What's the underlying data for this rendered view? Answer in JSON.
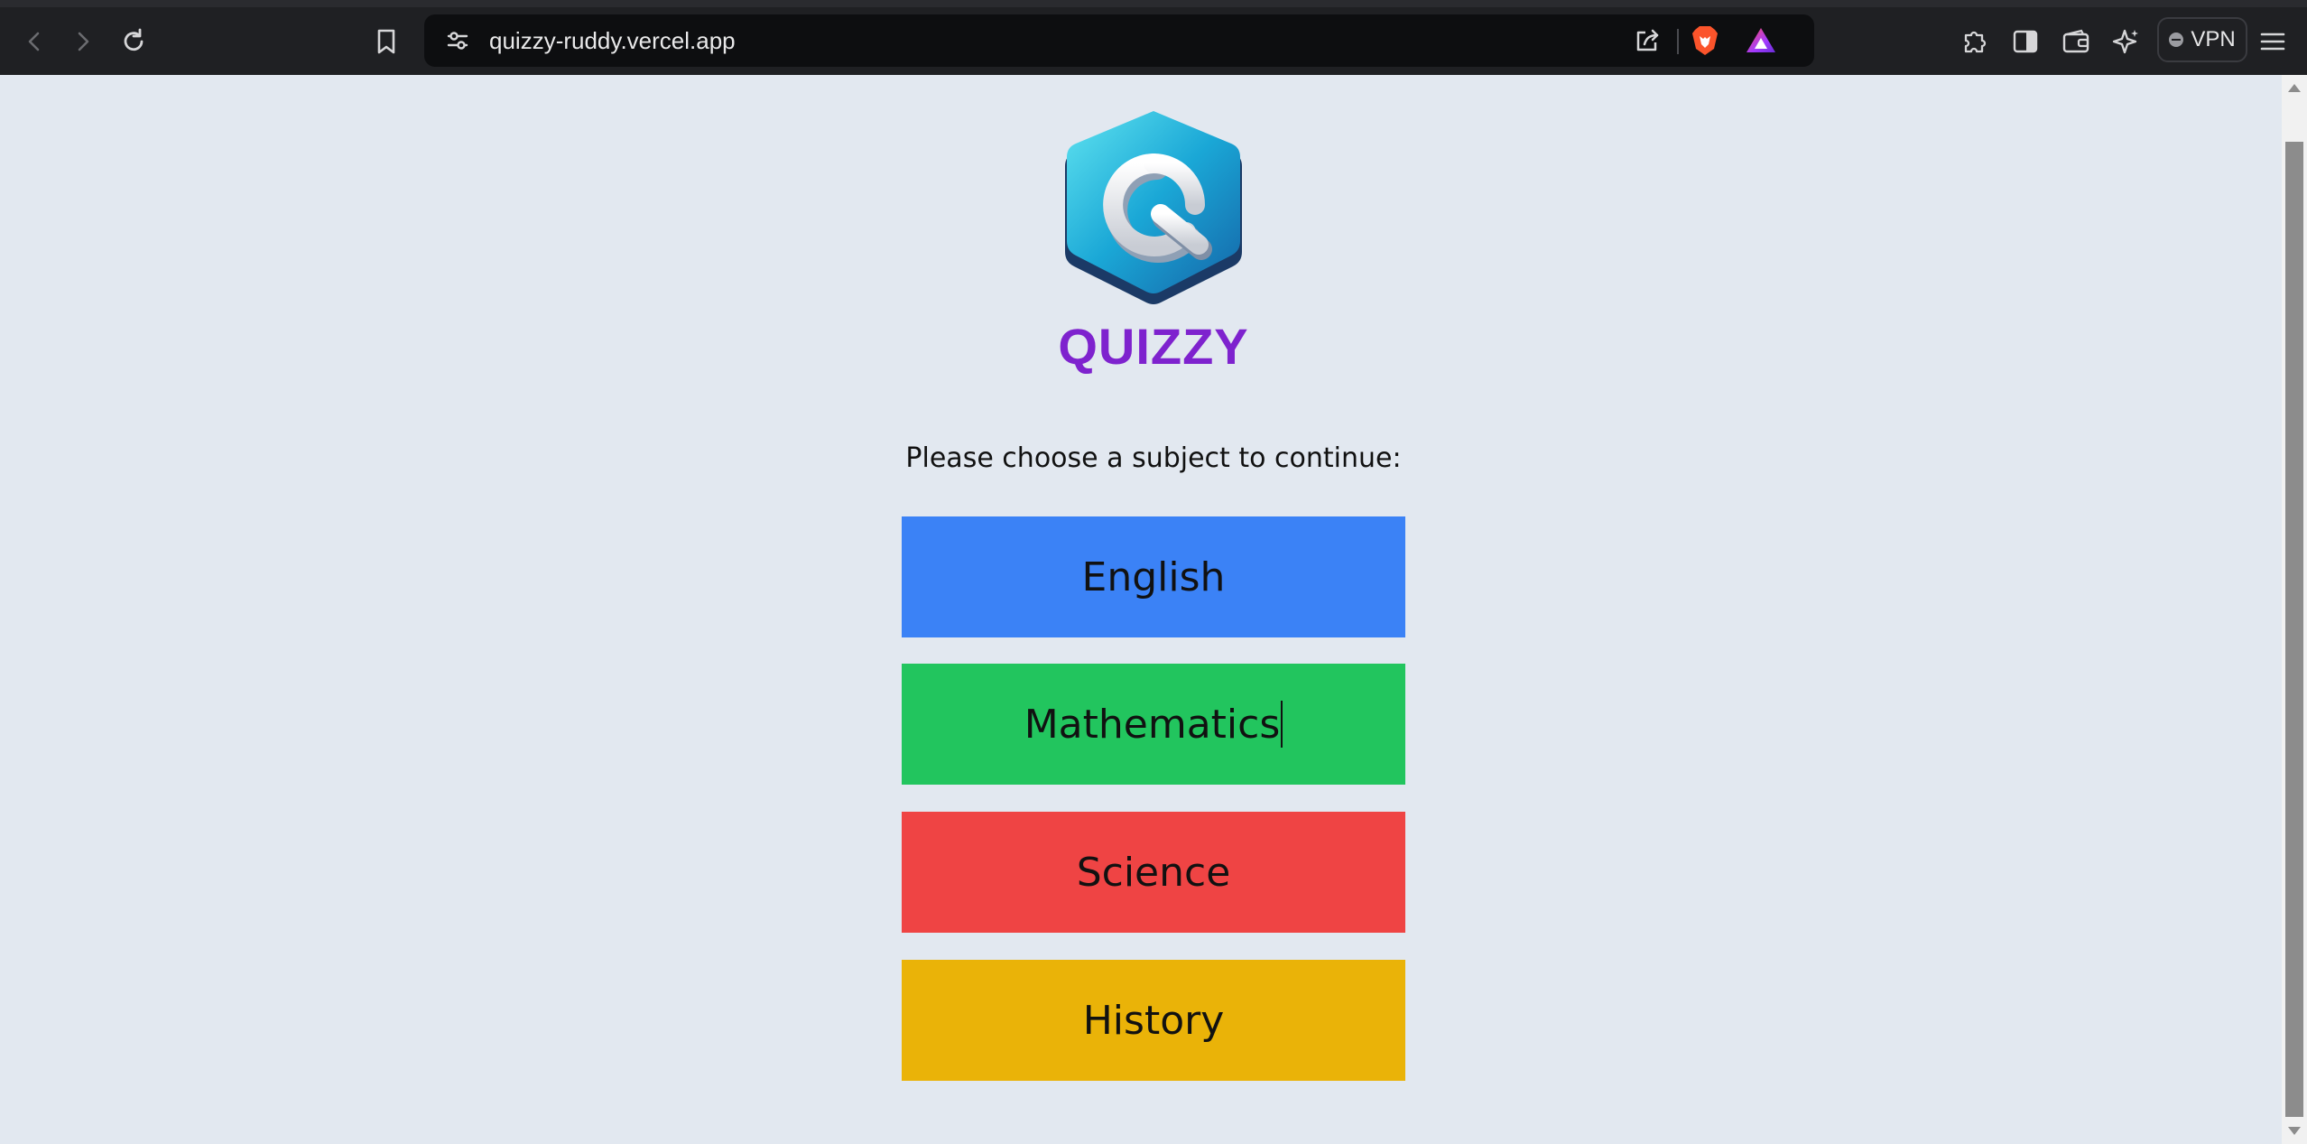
{
  "browser": {
    "url": "quizzy-ruddy.vercel.app",
    "vpn_label": "VPN",
    "icons": {
      "back": "back-arrow-icon",
      "forward": "forward-arrow-icon",
      "reload": "reload-icon",
      "bookmark": "bookmark-icon",
      "site_settings": "site-settings-icon",
      "share": "share-icon",
      "brave_shields": "brave-lion-icon",
      "rewards": "brave-rewards-icon",
      "extensions": "puzzle-icon",
      "sidebar": "sidebar-icon",
      "wallet": "wallet-icon",
      "leo": "sparkle-icon",
      "menu": "hamburger-menu-icon"
    }
  },
  "page": {
    "brand": "QUIZZY",
    "prompt": "Please choose a subject to continue:",
    "subjects": [
      {
        "label": "English",
        "color": "#3b82f6"
      },
      {
        "label": "Mathematics",
        "color": "#22c55e"
      },
      {
        "label": "Science",
        "color": "#ef4444"
      },
      {
        "label": "History",
        "color": "#eab308"
      }
    ],
    "brand_color": "#7e22ce",
    "background": "#e2e8f0"
  }
}
